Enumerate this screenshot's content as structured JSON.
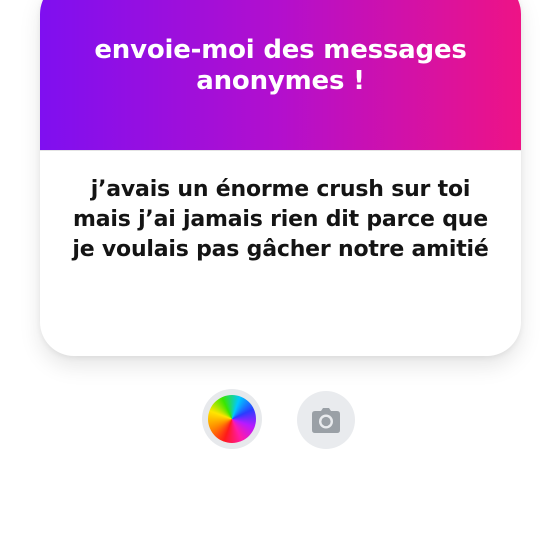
{
  "card": {
    "title": "envoie-moi des messages anonymes !",
    "message": "j’avais un énorme crush sur toi mais j’ai jamais rien dit parce que je voulais pas gâcher notre amitié"
  },
  "theme": {
    "gradient_start": "#7f0ff0",
    "gradient_end": "#ee1386",
    "text_color": "#141414",
    "button_bg": "#e9ebee",
    "icon_color": "#9aa0a6"
  },
  "controls": {
    "color_picker_icon": "rainbow-color-wheel-icon",
    "camera_icon": "camera-icon"
  }
}
